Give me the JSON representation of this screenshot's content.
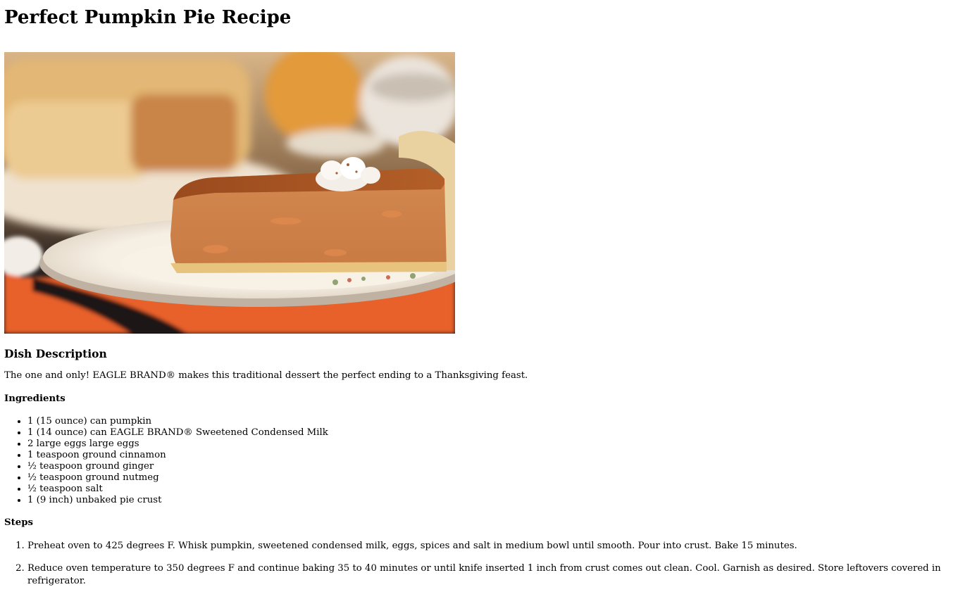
{
  "recipe": {
    "title": "Perfect Pumpkin Pie Recipe",
    "image_alt": "Slice of pumpkin pie with whipped cream on a white plate",
    "description_heading": "Dish Description",
    "description": "The one and only! EAGLE BRAND® makes this traditional dessert the perfect ending to a Thanksgiving feast.",
    "ingredients_heading": "Ingredients",
    "ingredients": [
      "1 (15 ounce) can pumpkin",
      "1 (14 ounce) can EAGLE BRAND® Sweetened Condensed Milk",
      "2 large eggs large eggs",
      "1 teaspoon ground cinnamon",
      "½ teaspoon ground ginger",
      "½ teaspoon ground nutmeg",
      "½ teaspoon salt",
      "1 (9 inch) unbaked pie crust"
    ],
    "steps_heading": "Steps",
    "steps": [
      "Preheat oven to 425 degrees F. Whisk pumpkin, sweetened condensed milk, eggs, spices and salt in medium bowl until smooth. Pour into crust. Bake 15 minutes.",
      "Reduce oven temperature to 350 degrees F and continue baking 35 to 40 minutes or until knife inserted 1 inch from crust comes out clean. Cool. Garnish as desired. Store leftovers covered in refrigerator."
    ]
  },
  "colors": {
    "background": "#ffffff",
    "text": "#000000",
    "pie_filling": "#c9733a",
    "crust": "#e9c98d",
    "plate": "#f4ece0",
    "tablecloth": "#e8612a"
  }
}
